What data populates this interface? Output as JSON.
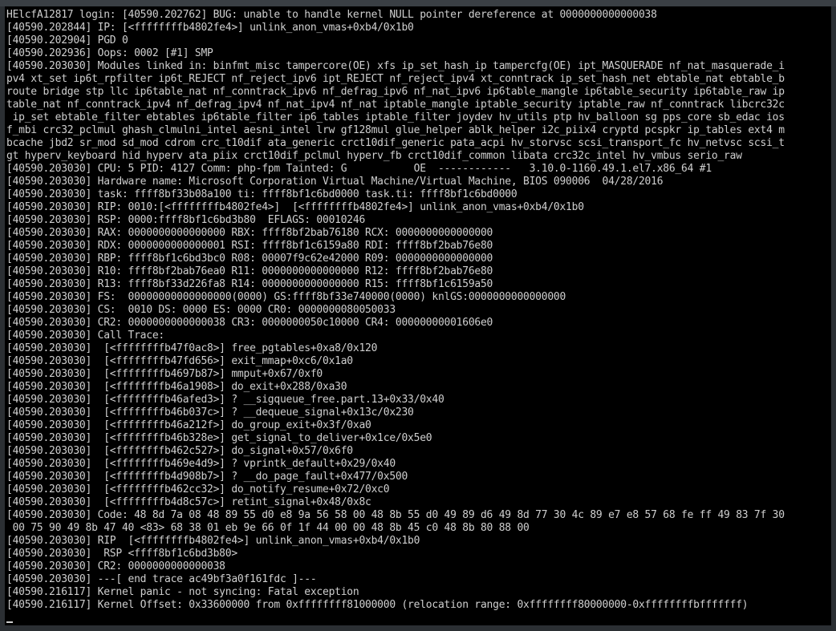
{
  "console": {
    "lines": [
      "HElcfA12817 login: [40590.202762] BUG: unable to handle kernel NULL pointer dereference at 0000000000000038",
      "[40590.202844] IP: [<ffffffffb4802fe4>] unlink_anon_vmas+0xb4/0x1b0",
      "[40590.202904] PGD 0",
      "[40590.202936] Oops: 0002 [#1] SMP",
      "[40590.203030] Modules linked in: binfmt_misc tampercore(OE) xfs ip_set_hash_ip tampercfg(OE) ipt_MASQUERADE nf_nat_masquerade_i",
      "pv4 xt_set ip6t_rpfilter ip6t_REJECT nf_reject_ipv6 ipt_REJECT nf_reject_ipv4 xt_conntrack ip_set_hash_net ebtable_nat ebtable_b",
      "route bridge stp llc ip6table_nat nf_conntrack_ipv6 nf_defrag_ipv6 nf_nat_ipv6 ip6table_mangle ip6table_security ip6table_raw ip",
      "table_nat nf_conntrack_ipv4 nf_defrag_ipv4 nf_nat_ipv4 nf_nat iptable_mangle iptable_security iptable_raw nf_conntrack libcrc32c",
      " ip_set ebtable_filter ebtables ip6table_filter ip6_tables iptable_filter joydev hv_utils ptp hv_balloon sg pps_core sb_edac ios",
      "f_mbi crc32_pclmul ghash_clmulni_intel aesni_intel lrw gf128mul glue_helper ablk_helper i2c_piix4 cryptd pcspkr ip_tables ext4 m",
      "bcache jbd2 sr_mod sd_mod cdrom crc_t10dif ata_generic crct10dif_generic pata_acpi hv_storvsc scsi_transport_fc hv_netvsc scsi_t",
      "gt hyperv_keyboard hid_hyperv ata_piix crct10dif_pclmul hyperv_fb crct10dif_common libata crc32c_intel hv_vmbus serio_raw",
      "[40590.203030] CPU: 5 PID: 4127 Comm: php-fpm Tainted: G           OE  ------------   3.10.0-1160.49.1.el7.x86_64 #1",
      "[40590.203030] Hardware name: Microsoft Corporation Virtual Machine/Virtual Machine, BIOS 090006  04/28/2016",
      "[40590.203030] task: ffff8bf33b08a100 ti: ffff8bf1c6bd0000 task.ti: ffff8bf1c6bd0000",
      "[40590.203030] RIP: 0010:[<ffffffffb4802fe4>]  [<ffffffffb4802fe4>] unlink_anon_vmas+0xb4/0x1b0",
      "[40590.203030] RSP: 0000:ffff8bf1c6bd3b80  EFLAGS: 00010246",
      "[40590.203030] RAX: 0000000000000000 RBX: ffff8bf2bab76180 RCX: 0000000000000000",
      "[40590.203030] RDX: 0000000000000001 RSI: ffff8bf1c6159a80 RDI: ffff8bf2bab76e80",
      "[40590.203030] RBP: ffff8bf1c6bd3bc0 R08: 00007f9c62e42000 R09: 0000000000000000",
      "[40590.203030] R10: ffff8bf2bab76ea0 R11: 0000000000000000 R12: ffff8bf2bab76e80",
      "[40590.203030] R13: ffff8bf33d226fa8 R14: 0000000000000000 R15: ffff8bf1c6159a50",
      "[40590.203030] FS:  00000000000000000(0000) GS:ffff8bf33e740000(0000) knlGS:0000000000000000",
      "[40590.203030] CS:  0010 DS: 0000 ES: 0000 CR0: 0000000080050033",
      "[40590.203030] CR2: 0000000000000038 CR3: 0000000050c10000 CR4: 00000000001606e0",
      "[40590.203030] Call Trace:",
      "[40590.203030]  [<ffffffffb47f0ac8>] free_pgtables+0xa8/0x120",
      "[40590.203030]  [<ffffffffb47fd656>] exit_mmap+0xc6/0x1a0",
      "[40590.203030]  [<ffffffffb4697b87>] mmput+0x67/0xf0",
      "[40590.203030]  [<ffffffffb46a1908>] do_exit+0x288/0xa30",
      "[40590.203030]  [<ffffffffb46afed3>] ? __sigqueue_free.part.13+0x33/0x40",
      "[40590.203030]  [<ffffffffb46b037c>] ? __dequeue_signal+0x13c/0x230",
      "[40590.203030]  [<ffffffffb46a212f>] do_group_exit+0x3f/0xa0",
      "[40590.203030]  [<ffffffffb46b328e>] get_signal_to_deliver+0x1ce/0x5e0",
      "[40590.203030]  [<ffffffffb462c527>] do_signal+0x57/0x6f0",
      "[40590.203030]  [<ffffffffb469e4d9>] ? vprintk_default+0x29/0x40",
      "[40590.203030]  [<ffffffffb4d908b7>] ? __do_page_fault+0x477/0x500",
      "[40590.203030]  [<ffffffffb462cc32>] do_notify_resume+0x72/0xc0",
      "[40590.203030]  [<ffffffffb4d8c57c>] retint_signal+0x48/0x8c",
      "[40590.203030] Code: 48 8d 7a 08 48 89 55 d0 e8 9a 56 58 00 48 8b 55 d0 49 89 d6 49 8d 77 30 4c 89 e7 e8 57 68 fe ff 49 83 7f 30",
      " 00 75 90 49 8b 47 40 <83> 68 38 01 eb 9e 66 0f 1f 44 00 00 48 8b 45 c0 48 8b 80 88 00",
      "[40590.203030] RIP  [<ffffffffb4802fe4>] unlink_anon_vmas+0xb4/0x1b0",
      "[40590.203030]  RSP <ffff8bf1c6bd3b80>",
      "[40590.203030] CR2: 0000000000000038",
      "[40590.203030] ---[ end trace ac49bf3a0f161fdc ]---",
      "[40590.216117] Kernel panic - not syncing: Fatal exception",
      "[40590.216117] Kernel Offset: 0x33600000 from 0xffffffff81000000 (relocation range: 0xffffffff80000000-0xffffffffbfffffff)"
    ]
  },
  "colors": {
    "background": "#000000",
    "text": "#cfcfcf",
    "frame": "#2b2f33"
  }
}
